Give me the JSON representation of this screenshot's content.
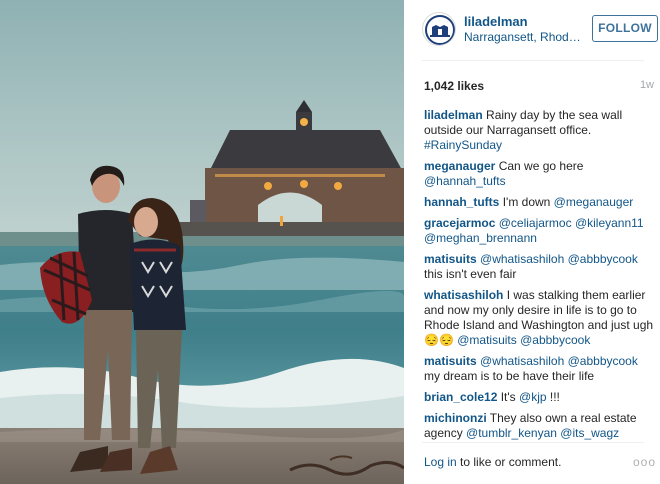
{
  "post": {
    "username": "liladelman",
    "location": "Narragansett, Rhod…",
    "follow_label": "FOLLOW",
    "likes": "1,042 likes",
    "time": "1w"
  },
  "comments": [
    {
      "user": "liladelman",
      "parts": [
        {
          "t": "Rainy day by the sea wall outside our Narragansett office. "
        },
        {
          "t": "#RainySunday",
          "link": true
        }
      ]
    },
    {
      "user": "meganauger",
      "parts": [
        {
          "t": "Can we go here "
        },
        {
          "t": "@hannah_tufts",
          "link": true
        }
      ]
    },
    {
      "user": "hannah_tufts",
      "parts": [
        {
          "t": "I'm down "
        },
        {
          "t": "@meganauger",
          "link": true
        }
      ]
    },
    {
      "user": "gracejarmoc",
      "parts": [
        {
          "t": "@celiajarmoc",
          "link": true
        },
        {
          "t": " "
        },
        {
          "t": "@kileyann11",
          "link": true
        },
        {
          "t": " "
        },
        {
          "t": "@meghan_brennann",
          "link": true
        }
      ]
    },
    {
      "user": "matisuits",
      "parts": [
        {
          "t": "@whatisashiloh",
          "link": true
        },
        {
          "t": " "
        },
        {
          "t": "@abbbycook",
          "link": true
        },
        {
          "t": " this isn't even fair"
        }
      ]
    },
    {
      "user": "whatisashiloh",
      "parts": [
        {
          "t": "I was stalking them earlier and now my only desire in life is to go to Rhode Island and Washington and just ugh 😔😔 "
        },
        {
          "t": "@matisuits",
          "link": true
        },
        {
          "t": " "
        },
        {
          "t": "@abbbycook",
          "link": true
        }
      ]
    },
    {
      "user": "matisuits",
      "parts": [
        {
          "t": "@whatisashiloh",
          "link": true
        },
        {
          "t": " "
        },
        {
          "t": "@abbbycook",
          "link": true
        },
        {
          "t": " my dream is to be have their life"
        }
      ]
    },
    {
      "user": "brian_cole12",
      "parts": [
        {
          "t": "It's "
        },
        {
          "t": "@kjp",
          "link": true
        },
        {
          "t": " !!!"
        }
      ]
    },
    {
      "user": "michinonzi",
      "parts": [
        {
          "t": "They also own a real estate agency "
        },
        {
          "t": "@tumblr_kenyan",
          "link": true
        },
        {
          "t": " "
        },
        {
          "t": "@its_wagz",
          "link": true
        }
      ]
    }
  ],
  "footer": {
    "login_link": "Log in",
    "login_rest": " to like or comment.",
    "more_label": "ooo"
  },
  "colors": {
    "link": "#125688",
    "text": "#262626",
    "muted": "#a5a7aa"
  },
  "icons": {
    "avatar": "lighthouse-logo-icon",
    "more": "more-options-icon"
  }
}
